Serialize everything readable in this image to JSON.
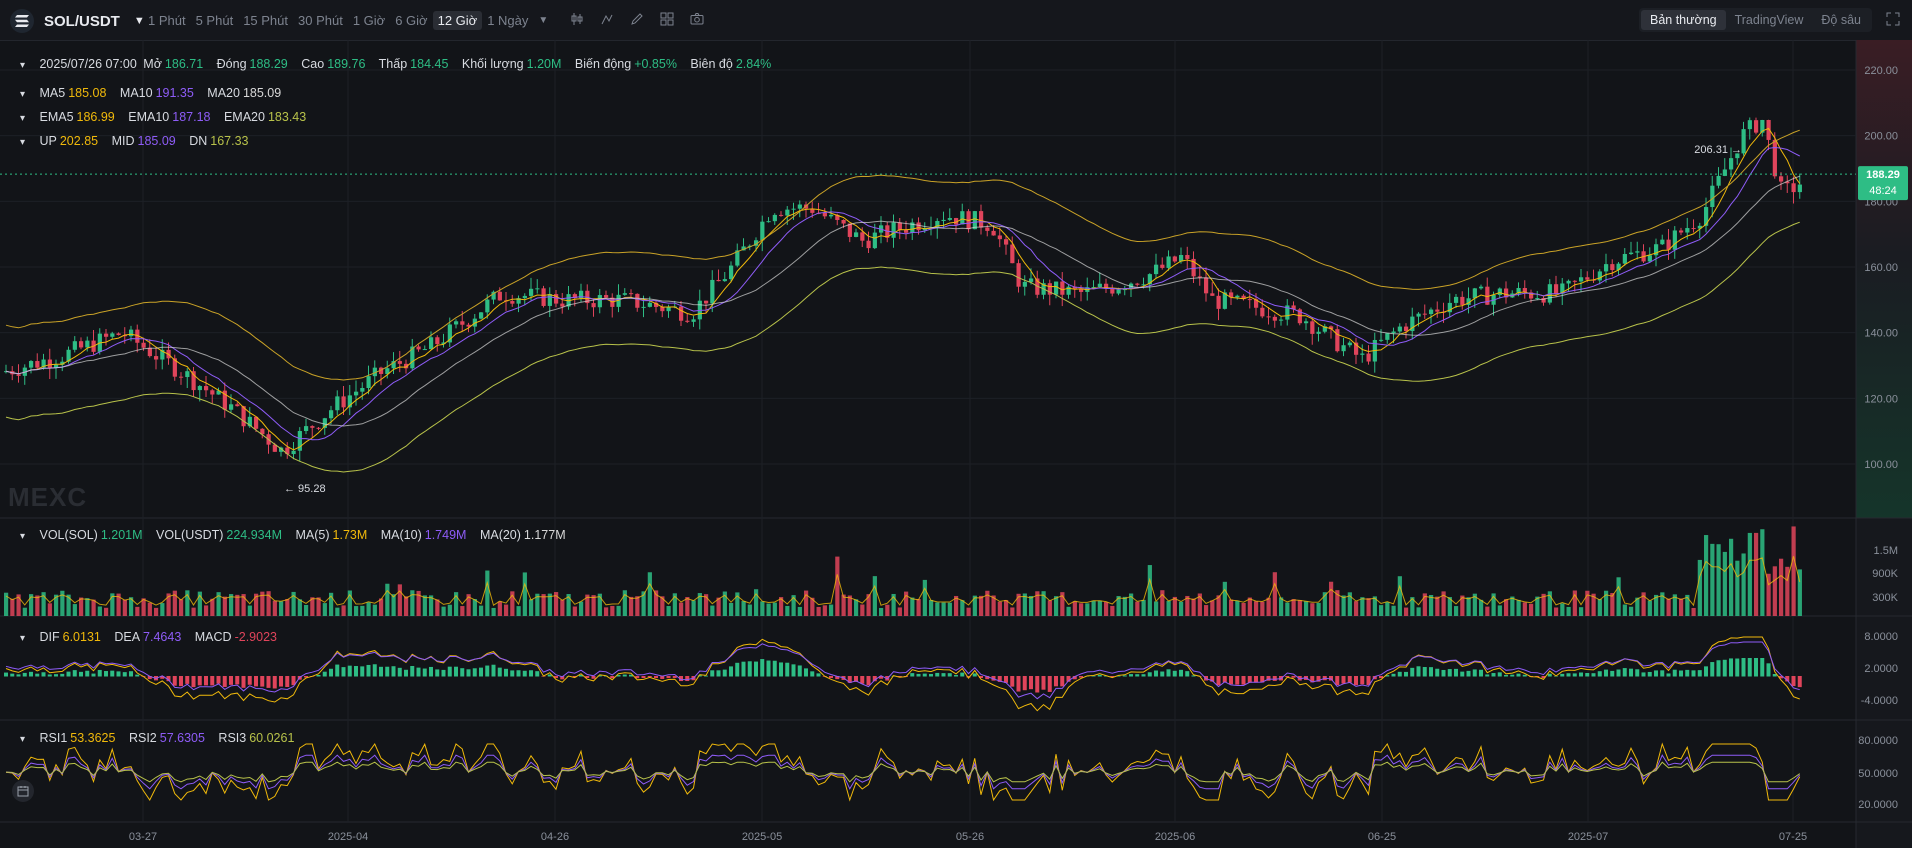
{
  "header": {
    "symbol": "SOL/USDT",
    "timeframes": [
      "1 Phút",
      "5 Phút",
      "15 Phút",
      "30 Phút",
      "1 Giờ",
      "6 Giờ",
      "12 Giờ",
      "1 Ngày"
    ],
    "active_timeframe": "12 Giờ",
    "view_modes": [
      "Bản thường",
      "TradingView",
      "Độ sâu"
    ],
    "active_mode": "Bản thường"
  },
  "ohlc": {
    "date": "2025/07/26 07:00",
    "open_label": "Mở",
    "open": "186.71",
    "close_label": "Đóng",
    "close": "188.29",
    "high_label": "Cao",
    "high": "189.76",
    "low_label": "Thấp",
    "low": "184.45",
    "volume_label": "Khối lượng",
    "volume": "1.20M",
    "change_label": "Biến động",
    "change": "+0.85%",
    "amplitude_label": "Biên độ",
    "amplitude": "2.84%"
  },
  "ma": {
    "ma5_label": "MA5",
    "ma5": "185.08",
    "ma10_label": "MA10",
    "ma10": "191.35",
    "ma20_label": "MA20",
    "ma20": "185.09"
  },
  "ema": {
    "ema5_label": "EMA5",
    "ema5": "186.99",
    "ema10_label": "EMA10",
    "ema10": "187.18",
    "ema20_label": "EMA20",
    "ema20": "183.43"
  },
  "boll": {
    "up_label": "UP",
    "up": "202.85",
    "mid_label": "MID",
    "mid": "185.09",
    "dn_label": "DN",
    "dn": "167.33"
  },
  "price_axis": {
    "ticks": [
      "220.00",
      "200.00",
      "180.00",
      "160.00",
      "140.00",
      "120.00",
      "100.00"
    ],
    "last_price": "188.29",
    "countdown": "48:24",
    "high_mark": "206.31",
    "low_mark": "95.28"
  },
  "watermark": "MEXC",
  "volume": {
    "sol_label": "VOL(SOL)",
    "sol": "1.201M",
    "usdt_label": "VOL(USDT)",
    "usdt": "224.934M",
    "ma5_label": "MA(5)",
    "ma5": "1.73M",
    "ma10_label": "MA(10)",
    "ma10": "1.749M",
    "ma20_label": "MA(20)",
    "ma20": "1.177M",
    "ticks": [
      "1.5M",
      "900K",
      "300K"
    ]
  },
  "macd": {
    "dif_label": "DIF",
    "dif": "6.0131",
    "dea_label": "DEA",
    "dea": "7.4643",
    "macd_label": "MACD",
    "macd": "-2.9023",
    "ticks": [
      "8.0000",
      "2.0000",
      "-4.0000"
    ]
  },
  "rsi": {
    "rsi1_label": "RSI1",
    "rsi1": "53.3625",
    "rsi2_label": "RSI2",
    "rsi2": "57.6305",
    "rsi3_label": "RSI3",
    "rsi3": "60.0261",
    "ticks": [
      "80.0000",
      "50.0000",
      "20.0000"
    ]
  },
  "time_axis": [
    "03-27",
    "2025-04",
    "04-26",
    "2025-05",
    "05-26",
    "2025-06",
    "06-25",
    "2025-07",
    "07-25"
  ],
  "colors": {
    "up": "#2ebd85",
    "down": "#e0445b",
    "ma5": "#f0b90b",
    "ma10": "#8e5cf7",
    "ma20": "#d8d8d8",
    "boll_up": "#c9a227",
    "boll_dn": "#b8c24a"
  }
}
